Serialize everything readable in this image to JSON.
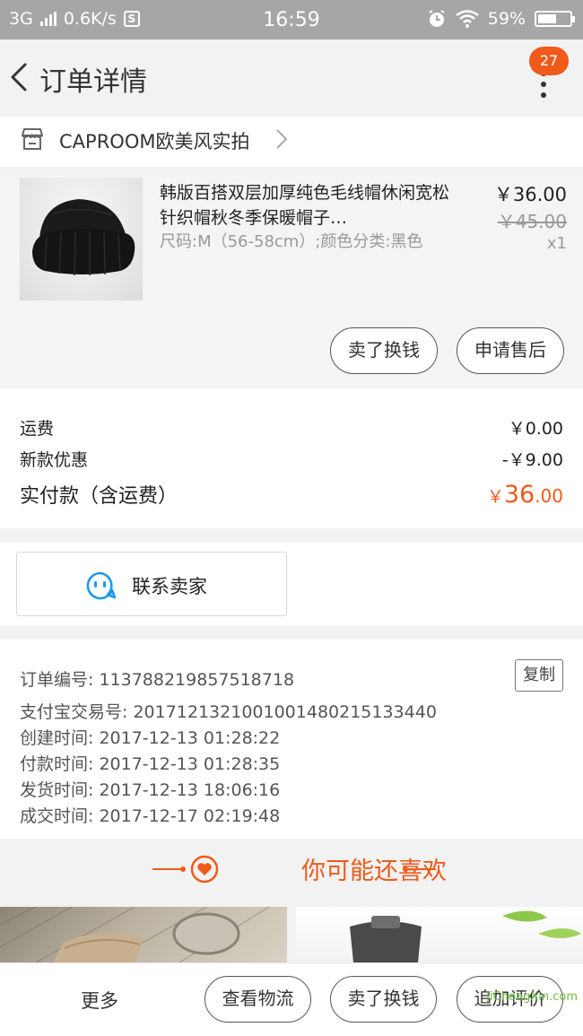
{
  "status_bar": {
    "network": "3G",
    "speed": "0.6K/s",
    "s_icon_label": "S",
    "time": "16:59",
    "battery_text": "59%",
    "battery_level": 0.59
  },
  "nav": {
    "title": "订单详情",
    "badge_count": "27"
  },
  "shop": {
    "name": "CAPROOM欧美风实拍"
  },
  "product": {
    "title": "韩版百搭双层加厚纯色毛线帽休闲宽松针织帽秋冬季保暖帽子…",
    "spec": "尺码:M（56-58cm）;颜色分类:黑色",
    "price": "￥36.00",
    "original_price": "￥45.00",
    "quantity": "x1",
    "sell_button": "卖了换钱",
    "aftersale_button": "申请售后"
  },
  "fees": {
    "shipping_label": "运费",
    "shipping_value": "￥0.00",
    "discount_label": "新款优惠",
    "discount_value": "-￥9.00",
    "paid_label": "实付款（含运费）",
    "paid_symbol": "￥",
    "paid_int": "36",
    "paid_dec": ".00"
  },
  "contact": {
    "label": "联系卖家"
  },
  "order_info": {
    "order_no": "订单编号: 113788219857518718",
    "alipay_no": "支付宝交易号: 2017121321001001480215133440",
    "created": "创建时间: 2017-12-13 01:28:22",
    "paid": "付款时间: 2017-12-13 01:28:35",
    "shipped": "发货时间: 2017-12-13 18:06:16",
    "completed": "成交时间: 2017-12-17 02:19:48",
    "copy_button": "复制"
  },
  "recommend": {
    "title": "你可能还喜欢"
  },
  "bottom_bar": {
    "more": "更多",
    "logistics_button": "查看物流",
    "sell_button": "卖了换钱",
    "review_button": "追加评价"
  },
  "watermark": {
    "text": "JiChengXin.com"
  },
  "colors": {
    "accent": "#f05a1a",
    "status_bar": "#a6a6a6",
    "background": "#f2f2f2",
    "contact_icon": "#1e9be8"
  }
}
